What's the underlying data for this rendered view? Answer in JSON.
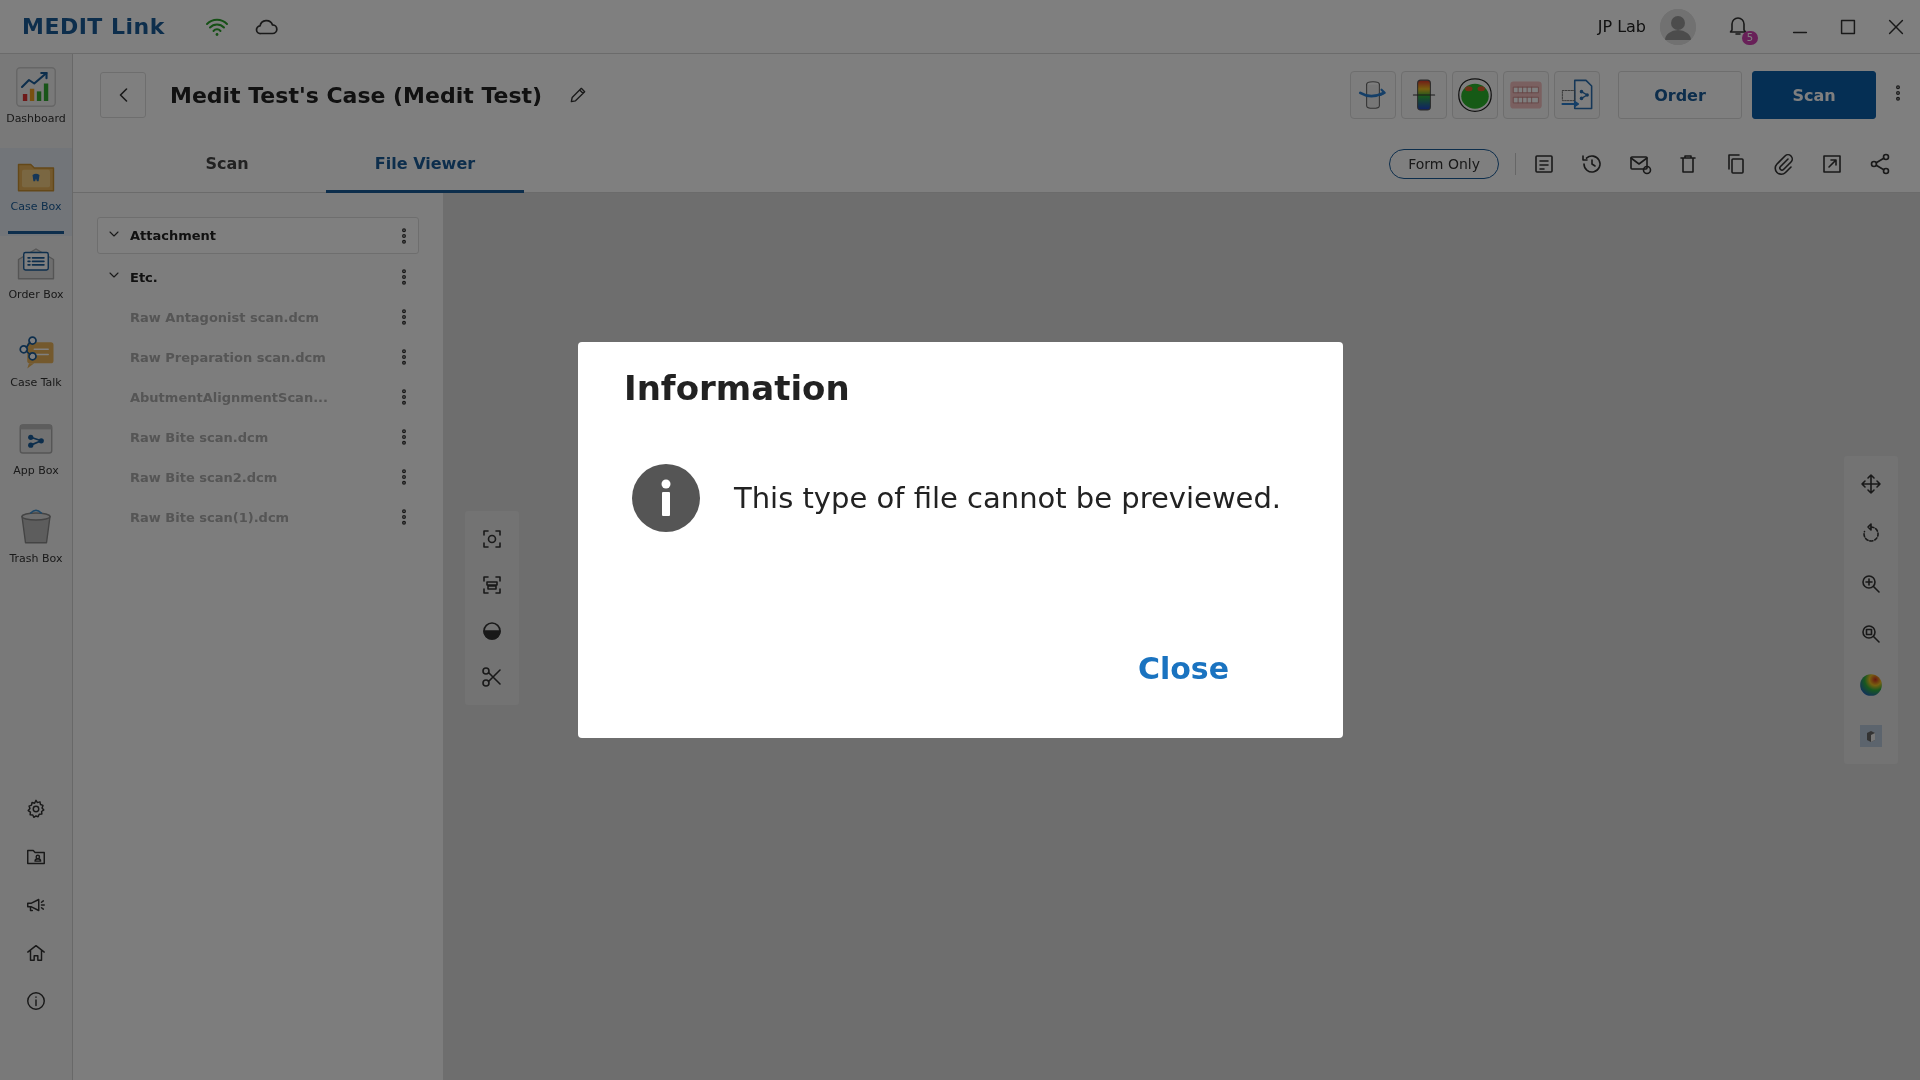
{
  "top_bar": {
    "brand": "MEDIT Link",
    "user_name": "JP Lab",
    "notification_count": "5"
  },
  "sidebar": {
    "items": [
      {
        "label": "Dashboard",
        "kind": "dashboard",
        "selected": false
      },
      {
        "label": "Case Box",
        "kind": "casebox",
        "selected": true
      },
      {
        "label": "Order Box",
        "kind": "orderbox",
        "selected": false
      },
      {
        "label": "Case Talk",
        "kind": "casetalk",
        "selected": false
      },
      {
        "label": "App Box",
        "kind": "appbox",
        "selected": false
      },
      {
        "label": "Trash Box",
        "kind": "trash",
        "selected": false
      }
    ]
  },
  "case_header": {
    "title": "Medit Test's Case (Medit Test)",
    "buttons": [
      {
        "label": "Order",
        "kind": "secondary"
      },
      {
        "label": "Scan",
        "kind": "primary"
      }
    ]
  },
  "tabs": [
    {
      "label": "Scan",
      "selected": false
    },
    {
      "label": "File Viewer",
      "selected": true
    }
  ],
  "toolbar": {
    "filter_button": "Form Only"
  },
  "file_tree": [
    {
      "label": "Attachment",
      "expanded": true,
      "selected": true
    },
    {
      "label": "Etc.",
      "expanded": true,
      "selected": false,
      "children": [
        {
          "label": "Raw Antagonist scan.dcm"
        },
        {
          "label": "Raw Preparation scan.dcm"
        },
        {
          "label": "AbutmentAlignmentScan..."
        },
        {
          "label": "Raw Bite scan.dcm"
        },
        {
          "label": "Raw Bite scan2.dcm"
        },
        {
          "label": "Raw Bite scan(1).dcm"
        }
      ]
    }
  ],
  "dialog": {
    "title": "Information",
    "message": "This type of file cannot be previewed.",
    "button": "Close"
  }
}
